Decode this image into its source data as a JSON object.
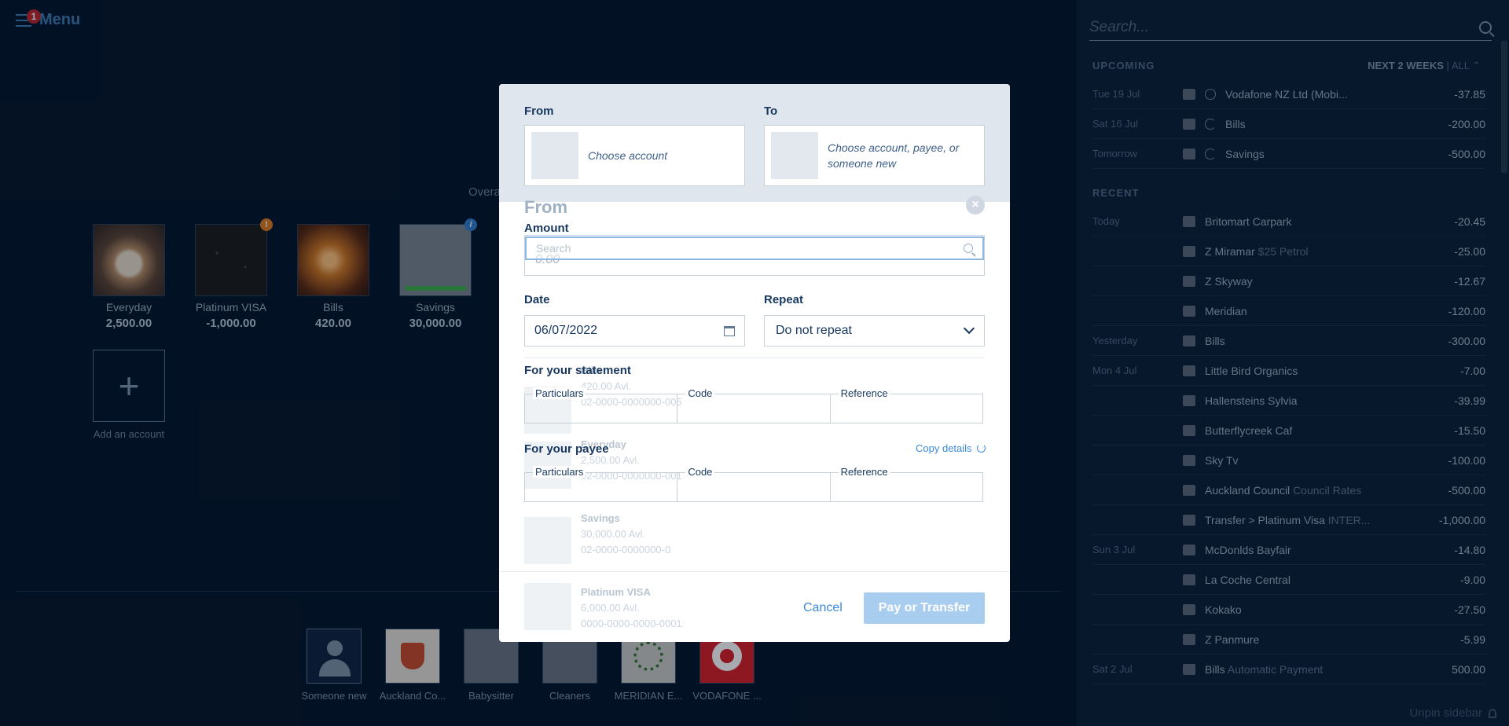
{
  "menu": {
    "label": "Menu",
    "badge": "1"
  },
  "overview_label": "Overa",
  "accounts": [
    {
      "name": "Everyday",
      "balance": "2,500.00"
    },
    {
      "name": "Platinum VISA",
      "balance": "-1,000.00",
      "badge": "!"
    },
    {
      "name": "Bills",
      "balance": "420.00"
    },
    {
      "name": "Savings",
      "balance": "30,000.00",
      "badge": "i"
    }
  ],
  "add_account": {
    "icon": "+",
    "label": "Add an account"
  },
  "payees": [
    {
      "label": "Someone new"
    },
    {
      "label": "Auckland Co..."
    },
    {
      "label": "Babysitter"
    },
    {
      "label": "Cleaners"
    },
    {
      "label": "MERIDIAN E..."
    },
    {
      "label": "VODAFONE ..."
    }
  ],
  "sidebar": {
    "search_placeholder": "Search...",
    "upcoming": {
      "title": "UPCOMING",
      "filter_active": "NEXT 2 WEEKS",
      "filter_sep": "|",
      "filter_all": "ALL",
      "items": [
        {
          "date": "Tue 19 Jul",
          "name": "Vodafone NZ Ltd (Mobi...",
          "amount": "-37.85",
          "icon": "clock"
        },
        {
          "date": "Sat 16 Jul",
          "name": "Bills",
          "amount": "-200.00",
          "icon": "cycle"
        },
        {
          "date": "Tomorrow",
          "name": "Savings",
          "amount": "-500.00",
          "icon": "cycle"
        }
      ]
    },
    "recent": {
      "title": "RECENT",
      "items": [
        {
          "date": "Today",
          "name": "Britomart Carpark",
          "extra": "",
          "amount": "-20.45"
        },
        {
          "date": "",
          "name": "Z Miramar",
          "extra": "$25 Petrol",
          "amount": "-25.00"
        },
        {
          "date": "",
          "name": "Z Skyway",
          "extra": "",
          "amount": "-12.67"
        },
        {
          "date": "",
          "name": "Meridian",
          "extra": "",
          "amount": "-120.00"
        },
        {
          "date": "Yesterday",
          "name": "Bills",
          "extra": "",
          "amount": "-300.00"
        },
        {
          "date": "Mon 4 Jul",
          "name": "Little Bird Organics",
          "extra": "",
          "amount": "-7.00"
        },
        {
          "date": "",
          "name": "Hallensteins Sylvia",
          "extra": "",
          "amount": "-39.99"
        },
        {
          "date": "",
          "name": "Butterflycreek Caf",
          "extra": "",
          "amount": "-15.50"
        },
        {
          "date": "",
          "name": "Sky Tv",
          "extra": "",
          "amount": "-100.00"
        },
        {
          "date": "",
          "name": "Auckland Council",
          "extra": "Council Rates",
          "amount": "-500.00"
        },
        {
          "date": "",
          "name": "Transfer > Platinum Visa",
          "extra": "INTER...",
          "amount": "-1,000.00"
        },
        {
          "date": "Sun 3 Jul",
          "name": "McDonlds Bayfair",
          "extra": "",
          "amount": "-14.80"
        },
        {
          "date": "",
          "name": "La Coche Central",
          "extra": "",
          "amount": "-9.00"
        },
        {
          "date": "",
          "name": "Kokako",
          "extra": "",
          "amount": "-27.50"
        },
        {
          "date": "",
          "name": "Z Panmure",
          "extra": "",
          "amount": "-5.99"
        },
        {
          "date": "Sat 2 Jul",
          "name": "Bills",
          "extra": "Automatic Payment",
          "amount": "500.00"
        }
      ]
    },
    "unpin_label": "Unpin sidebar"
  },
  "modal": {
    "from_label": "From",
    "to_label": "To",
    "from_placeholder": "Choose account",
    "to_placeholder_line1": "Choose account, payee, or",
    "to_placeholder_line2": "someone new",
    "ghost_from": "From",
    "close_icon": "×",
    "amount_label": "Amount",
    "amount_search_placeholder": "Search",
    "amount_value": "0.00",
    "date_label": "Date",
    "date_value": "06/07/2022",
    "repeat_label": "Repeat",
    "repeat_value": "Do not repeat",
    "statement_label": "For your statement",
    "payee_label": "For your payee",
    "copy_details": "Copy details",
    "particulars": "Particulars",
    "code": "Code",
    "reference": "Reference",
    "cancel": "Cancel",
    "submit": "Pay or Transfer",
    "ghost_accounts": [
      {
        "name": "Bills",
        "avail": "420.00 Avl.",
        "number": "02-0000-0000000-005"
      },
      {
        "name": "Everyday",
        "avail": "2,500.00 Avl.",
        "number": "02-0000-0000000-001"
      },
      {
        "name": "Savings",
        "avail": "30,000.00 Avl.",
        "number": "02-0000-0000000-0"
      },
      {
        "name": "Platinum VISA",
        "avail": "6,000.00 Avl.",
        "number": "0000-0000-0000-0001"
      }
    ]
  }
}
